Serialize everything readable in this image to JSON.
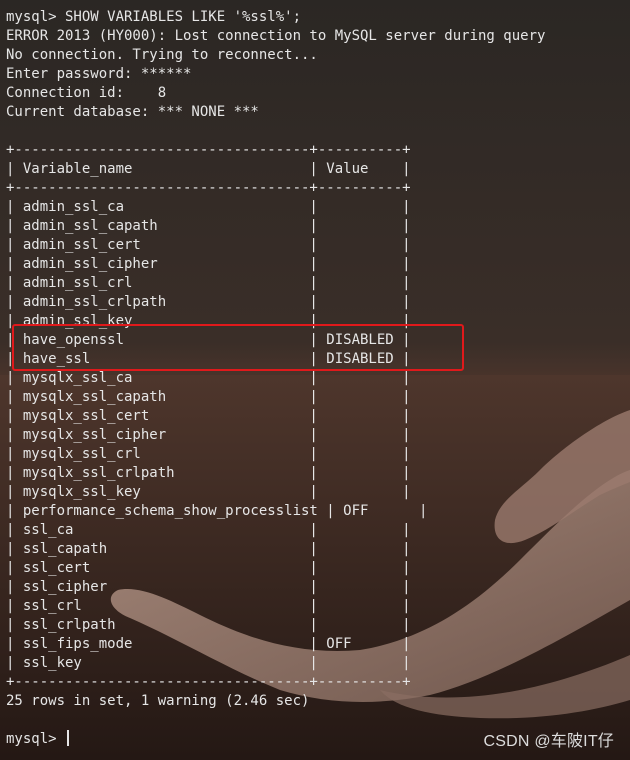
{
  "terminal": {
    "lines": [
      "mysql> SHOW VARIABLES LIKE '%ssl%';",
      "ERROR 2013 (HY000): Lost connection to MySQL server during query",
      "No connection. Trying to reconnect...",
      "Enter password: ******",
      "Connection id:    8",
      "Current database: *** NONE ***",
      "",
      "+-----------------------------------+----------+",
      "| Variable_name                     | Value    |",
      "+-----------------------------------+----------+",
      "| admin_ssl_ca                      |          |",
      "| admin_ssl_capath                  |          |",
      "| admin_ssl_cert                    |          |",
      "| admin_ssl_cipher                  |          |",
      "| admin_ssl_crl                     |          |",
      "| admin_ssl_crlpath                 |          |",
      "| admin_ssl_key                     |          |",
      "| have_openssl                      | DISABLED |",
      "| have_ssl                          | DISABLED |",
      "| mysqlx_ssl_ca                     |          |",
      "| mysqlx_ssl_capath                 |          |",
      "| mysqlx_ssl_cert                   |          |",
      "| mysqlx_ssl_cipher                 |          |",
      "| mysqlx_ssl_crl                    |          |",
      "| mysqlx_ssl_crlpath                |          |",
      "| mysqlx_ssl_key                    |          |",
      "| performance_schema_show_processlist | OFF      |",
      "| ssl_ca                            |          |",
      "| ssl_capath                        |          |",
      "| ssl_cert                          |          |",
      "| ssl_cipher                        |          |",
      "| ssl_crl                           |          |",
      "| ssl_crlpath                       |          |",
      "| ssl_fips_mode                     | OFF      |",
      "| ssl_key                           |          |",
      "+-----------------------------------+----------+",
      "25 rows in set, 1 warning (2.46 sec)",
      ""
    ],
    "prompt": "mysql> "
  },
  "watermark": "CSDN @车陂IT仔",
  "colors": {
    "text": "#e6e6e6",
    "highlight_border": "#e0191b",
    "background": "#2a211d"
  }
}
